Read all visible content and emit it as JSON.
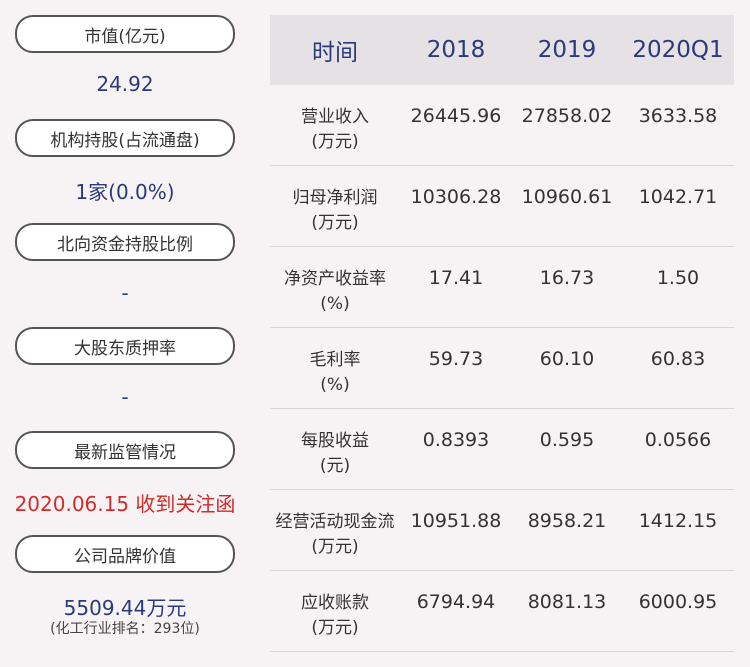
{
  "left": {
    "market_cap_label": "市值(亿元)",
    "market_cap_value": "24.92",
    "institution_label": "机构持股(占流通盘)",
    "institution_value": "1家(0.0%)",
    "northbound_label": "北向资金持股比例",
    "northbound_value": "-",
    "pledge_label": "大股东质押率",
    "pledge_value": "-",
    "supervision_label": "最新监管情况",
    "supervision_value": "2020.06.15 收到关注函",
    "brand_label": "公司品牌价值",
    "brand_value": "5509.44万元",
    "brand_rank": "(化工行业排名：293位)"
  },
  "table": {
    "headers": [
      "时间",
      "2018",
      "2019",
      "2020Q1"
    ],
    "rows": [
      {
        "label1": "营业收入",
        "label2": "(万元)",
        "v": [
          "26445.96",
          "27858.02",
          "3633.58"
        ]
      },
      {
        "label1": "归母净利润",
        "label2": "(万元)",
        "v": [
          "10306.28",
          "10960.61",
          "1042.71"
        ]
      },
      {
        "label1": "净资产收益率",
        "label2": "(%)",
        "v": [
          "17.41",
          "16.73",
          "1.50"
        ]
      },
      {
        "label1": "毛利率",
        "label2": "(%)",
        "v": [
          "59.73",
          "60.10",
          "60.83"
        ]
      },
      {
        "label1": "每股收益",
        "label2": "(元)",
        "v": [
          "0.8393",
          "0.595",
          "0.0566"
        ]
      },
      {
        "label1": "经营活动现金流",
        "label2": "(万元)",
        "v": [
          "10951.88",
          "8958.21",
          "1412.15"
        ]
      },
      {
        "label1": "应收账款",
        "label2": "(万元)",
        "v": [
          "6794.94",
          "8081.13",
          "6000.95"
        ]
      }
    ]
  }
}
